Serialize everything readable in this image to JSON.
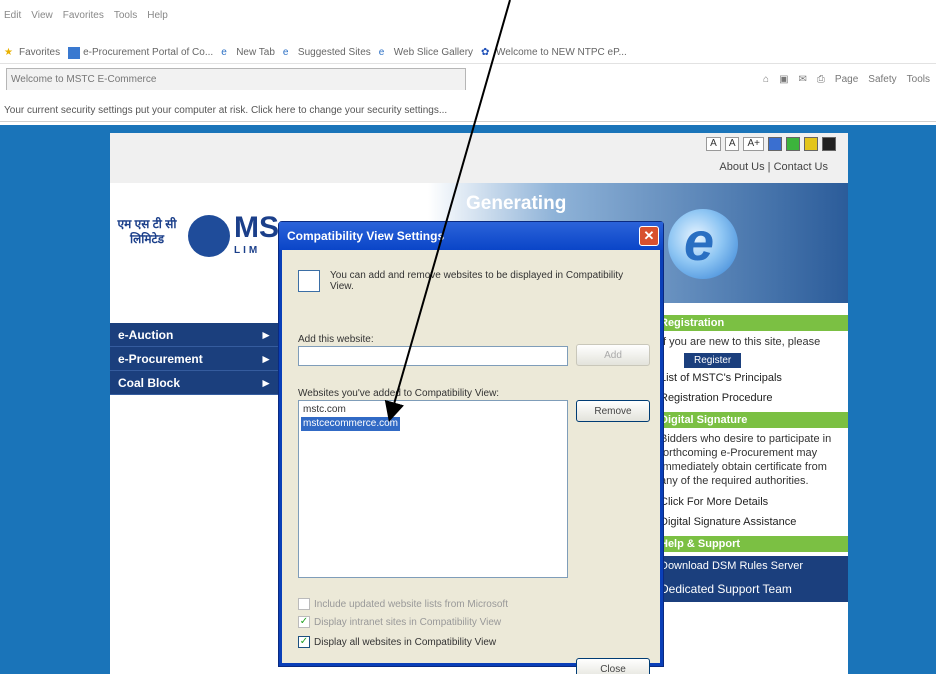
{
  "browser": {
    "menu": [
      "Edit",
      "View",
      "Favorites",
      "Tools",
      "Help"
    ],
    "favorites": [
      {
        "label": "Favorites"
      },
      {
        "label": "e-Procurement Portal of Co..."
      },
      {
        "label": "New Tab"
      },
      {
        "label": "Suggested Sites"
      },
      {
        "label": "Web Slice Gallery"
      },
      {
        "label": "Welcome to NEW NTPC eP..."
      }
    ],
    "tab_title": "Welcome to MSTC E-Commerce",
    "command_bar": [
      "Page",
      "Safety",
      "Tools"
    ],
    "info_bar": "Your current security settings put your computer at risk. Click here to change your security settings..."
  },
  "site": {
    "font_buttons": [
      "A",
      "A",
      "A+"
    ],
    "top_links": "About Us | Contact Us",
    "banner_title": "Generating",
    "logo_hindi": [
      "एम एस टी सी",
      "लिमिटेड"
    ],
    "logo_ms": "MS",
    "logo_lim": "LIM",
    "ie_letter": "e",
    "nav": [
      {
        "label": "e-Auction",
        "arrow": "►"
      },
      {
        "label": "e-Procurement",
        "arrow": "►"
      },
      {
        "label": "Coal Block",
        "arrow": "►"
      }
    ],
    "right": {
      "reg_head": "Registration",
      "reg_text": "If you are new to this site, please",
      "reg_button": "Register",
      "principals": "List of MSTC's Principals",
      "procedure": "Registration Procedure",
      "dsc_head": "Digital Signature",
      "dsc_text": "Bidders who desire to participate in forthcoming e-Procurement may immediately obtain certificate from any of the required authorities.",
      "more": "Click For More Details",
      "assist": "Digital Signature Assistance",
      "help_head": "Help & Support",
      "help_text": "Download DSM Rules Server",
      "support": "Dedicated Support Team"
    }
  },
  "dialog": {
    "title": "Compatibility View Settings",
    "close": "✕",
    "intro": "You can add and remove websites to be displayed in Compatibility View.",
    "add_label": "Add this website:",
    "add_value": "",
    "add_button": "Add",
    "list_label": "Websites you've added to Compatibility View:",
    "list_items": [
      "mstc.com",
      "mstcecommerce.com"
    ],
    "remove_button": "Remove",
    "checkboxes": [
      {
        "label": "Include updated website lists from Microsoft",
        "checked": false,
        "disabled": true
      },
      {
        "label": "Display intranet sites in Compatibility View",
        "checked": true,
        "disabled": true
      },
      {
        "label": "Display all websites in Compatibility View",
        "checked": true,
        "disabled": false
      }
    ],
    "close_button": "Close"
  }
}
